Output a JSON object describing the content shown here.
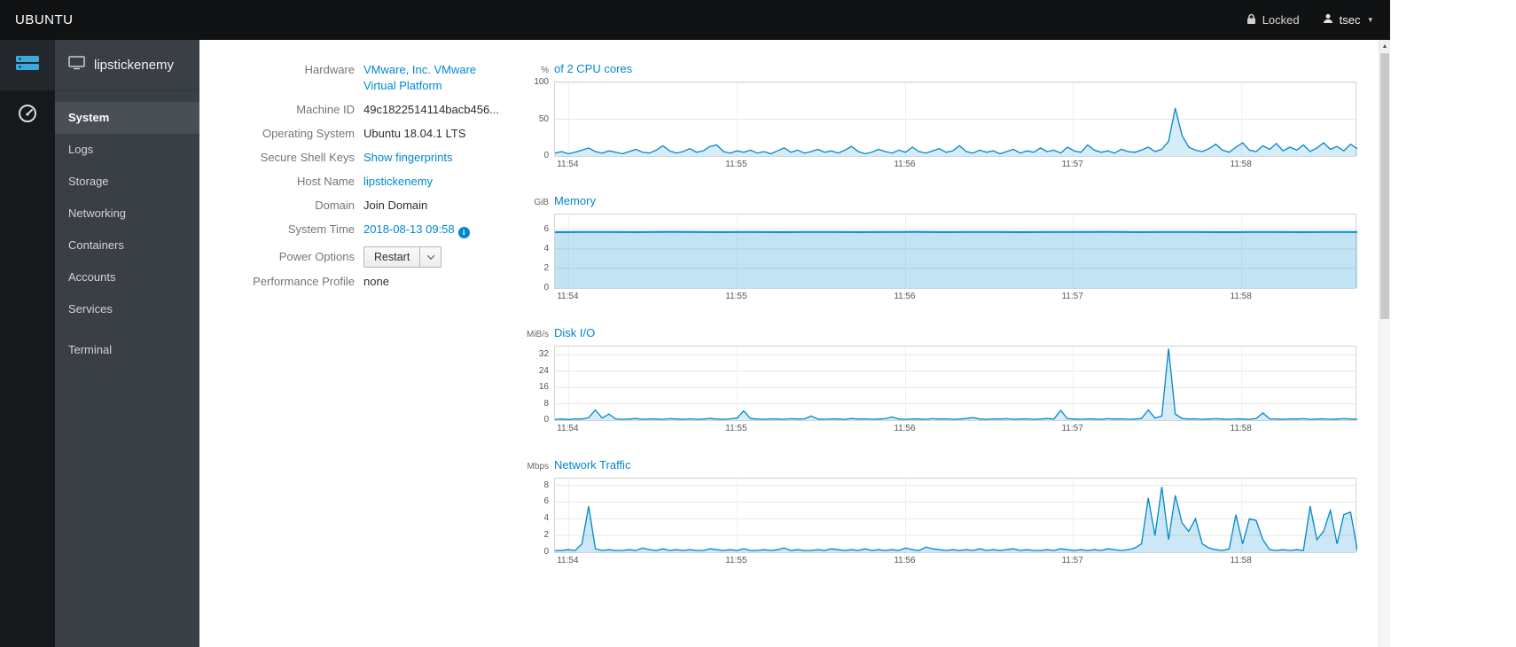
{
  "topbar": {
    "brand": "UBUNTU",
    "locked_label": "Locked",
    "user_label": "tsec"
  },
  "sidebar": {
    "host": "lipstickenemy",
    "items": [
      {
        "label": "System"
      },
      {
        "label": "Logs"
      },
      {
        "label": "Storage"
      },
      {
        "label": "Networking"
      },
      {
        "label": "Containers"
      },
      {
        "label": "Accounts"
      },
      {
        "label": "Services"
      },
      {
        "label": "Terminal"
      }
    ]
  },
  "system": {
    "hardware_label": "Hardware",
    "hardware_value": "VMware, Inc. VMware Virtual Platform",
    "machine_id_label": "Machine ID",
    "machine_id_value": "49c1822514114bacb456...",
    "os_label": "Operating System",
    "os_value": "Ubuntu 18.04.1 LTS",
    "ssh_label": "Secure Shell Keys",
    "ssh_value": "Show fingerprints",
    "hostname_label": "Host Name",
    "hostname_value": "lipstickenemy",
    "domain_label": "Domain",
    "domain_value": "Join Domain",
    "time_label": "System Time",
    "time_value": "2018-08-13 09:58",
    "time_info_icon": "i",
    "power_label": "Power Options",
    "power_value": "Restart",
    "profile_label": "Performance Profile",
    "profile_value": "none"
  },
  "chart_data": [
    {
      "type": "area",
      "unit": "%",
      "title": "of 2 CPU cores",
      "ymax": 100,
      "yticks": [
        0,
        50,
        100
      ],
      "xticks": [
        "11:54",
        "11:55",
        "11:56",
        "11:57",
        "11:58"
      ],
      "xtick_pos": [
        0.017,
        0.227,
        0.437,
        0.646,
        0.856
      ],
      "line_color": "#0088ce",
      "fill": "rgba(0,136,206,0.16)",
      "line_width": 1.3,
      "values": [
        4,
        6,
        3,
        5,
        8,
        11,
        6,
        4,
        7,
        5,
        3,
        6,
        9,
        5,
        4,
        8,
        14,
        7,
        4,
        6,
        10,
        5,
        7,
        13,
        15,
        6,
        4,
        7,
        5,
        8,
        4,
        6,
        3,
        7,
        11,
        5,
        8,
        4,
        6,
        9,
        5,
        7,
        4,
        8,
        13,
        6,
        3,
        5,
        9,
        6,
        4,
        8,
        5,
        12,
        6,
        4,
        7,
        10,
        5,
        7,
        14,
        6,
        4,
        8,
        5,
        7,
        3,
        6,
        9,
        4,
        7,
        5,
        11,
        6,
        8,
        4,
        12,
        7,
        5,
        15,
        8,
        5,
        7,
        4,
        9,
        6,
        5,
        8,
        12,
        6,
        9,
        20,
        65,
        28,
        12,
        8,
        6,
        10,
        16,
        8,
        5,
        12,
        18,
        8,
        6,
        14,
        9,
        17,
        7,
        12,
        8,
        15,
        6,
        11,
        18,
        9,
        13,
        7,
        16,
        10
      ]
    },
    {
      "type": "area",
      "unit": "GiB",
      "title": "Memory",
      "ymax": 7.5,
      "yticks": [
        0,
        2,
        4,
        6
      ],
      "xticks": [
        "11:54",
        "11:55",
        "11:56",
        "11:57",
        "11:58"
      ],
      "xtick_pos": [
        0.017,
        0.227,
        0.437,
        0.646,
        0.856
      ],
      "line_color": "#0088ce",
      "fill": "rgba(0,136,206,0.24)",
      "line_width": 2,
      "values": [
        5.7,
        5.72,
        5.71,
        5.7,
        5.73,
        5.71,
        5.7,
        5.72,
        5.7,
        5.71,
        5.72,
        5.7,
        5.71,
        5.73,
        5.7,
        5.72,
        5.71,
        5.7,
        5.72,
        5.71,
        5.73,
        5.7,
        5.71,
        5.72,
        5.7,
        5.71,
        5.72,
        5.7,
        5.72,
        5.71
      ]
    },
    {
      "type": "area",
      "unit": "MiB/s",
      "title": "Disk I/O",
      "ymax": 36,
      "yticks": [
        0,
        8,
        16,
        24,
        32
      ],
      "xticks": [
        "11:54",
        "11:55",
        "11:56",
        "11:57",
        "11:58"
      ],
      "xtick_pos": [
        0.017,
        0.227,
        0.437,
        0.646,
        0.856
      ],
      "line_color": "#0088ce",
      "fill": "rgba(0,136,206,0.16)",
      "line_width": 1.3,
      "values": [
        0.4,
        0.5,
        0.3,
        0.6,
        0.5,
        1.2,
        5,
        1,
        3,
        0.6,
        0.4,
        0.5,
        0.8,
        0.4,
        0.6,
        0.5,
        0.4,
        0.7,
        0.5,
        0.4,
        0.6,
        0.4,
        0.5,
        0.8,
        0.5,
        0.4,
        0.6,
        1,
        4.5,
        0.8,
        0.5,
        0.4,
        0.6,
        0.5,
        0.4,
        0.7,
        0.5,
        0.6,
        2,
        0.5,
        0.4,
        0.6,
        0.5,
        0.4,
        0.8,
        0.5,
        0.6,
        0.4,
        0.5,
        0.7,
        1.5,
        0.5,
        0.4,
        0.6,
        0.5,
        0.4,
        0.7,
        0.5,
        0.6,
        0.4,
        0.5,
        0.8,
        1.2,
        0.5,
        0.4,
        0.6,
        0.5,
        0.7,
        0.4,
        0.5,
        0.6,
        0.4,
        0.5,
        0.8,
        0.5,
        4.8,
        0.7,
        0.5,
        0.4,
        0.6,
        0.5,
        0.4,
        0.7,
        0.5,
        0.6,
        0.4,
        0.5,
        0.8,
        5,
        1,
        2,
        35,
        3,
        0.8,
        0.5,
        0.6,
        0.4,
        0.5,
        0.7,
        0.5,
        0.4,
        0.6,
        0.5,
        0.4,
        0.8,
        3.5,
        0.6,
        0.5,
        0.4,
        0.6,
        0.5,
        0.7,
        0.4,
        0.5,
        0.6,
        0.4,
        0.5,
        0.7,
        0.5,
        0.4
      ]
    },
    {
      "type": "area",
      "unit": "Mbps",
      "title": "Network Traffic",
      "ymax": 8.8,
      "yticks": [
        0,
        2,
        4,
        6,
        8
      ],
      "xticks": [
        "11:54",
        "11:55",
        "11:56",
        "11:57",
        "11:58"
      ],
      "xtick_pos": [
        0.017,
        0.227,
        0.437,
        0.646,
        0.856
      ],
      "line_color": "#0088ce",
      "fill": "rgba(0,136,206,0.2)",
      "line_width": 1.3,
      "values": [
        0.2,
        0.2,
        0.3,
        0.2,
        1,
        5.5,
        0.4,
        0.2,
        0.3,
        0.2,
        0.2,
        0.3,
        0.2,
        0.5,
        0.3,
        0.2,
        0.4,
        0.2,
        0.3,
        0.2,
        0.3,
        0.2,
        0.2,
        0.4,
        0.3,
        0.2,
        0.3,
        0.2,
        0.4,
        0.2,
        0.2,
        0.3,
        0.2,
        0.3,
        0.5,
        0.2,
        0.3,
        0.2,
        0.2,
        0.3,
        0.2,
        0.4,
        0.3,
        0.2,
        0.3,
        0.2,
        0.4,
        0.2,
        0.3,
        0.2,
        0.3,
        0.2,
        0.5,
        0.3,
        0.2,
        0.6,
        0.4,
        0.3,
        0.2,
        0.3,
        0.2,
        0.3,
        0.2,
        0.4,
        0.2,
        0.3,
        0.2,
        0.3,
        0.4,
        0.2,
        0.3,
        0.2,
        0.2,
        0.3,
        0.2,
        0.4,
        0.3,
        0.2,
        0.3,
        0.2,
        0.3,
        0.2,
        0.4,
        0.3,
        0.2,
        0.3,
        0.5,
        1,
        6.5,
        2,
        7.8,
        1.5,
        6.8,
        3.5,
        2.5,
        4,
        1,
        0.5,
        0.3,
        0.2,
        0.4,
        4.5,
        1,
        4,
        3.8,
        1.5,
        0.3,
        0.2,
        0.3,
        0.2,
        0.3,
        0.2,
        5.5,
        1.5,
        2.5,
        5,
        1,
        4.5,
        4.8,
        0.3
      ]
    }
  ]
}
